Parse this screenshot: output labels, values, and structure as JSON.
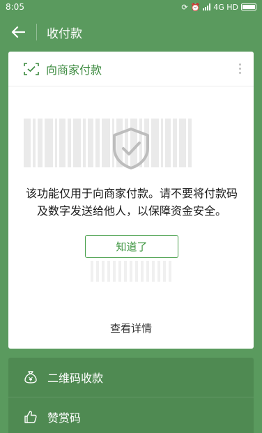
{
  "status_bar": {
    "time": "8:05",
    "network": "4G HD"
  },
  "header": {
    "title": "收付款"
  },
  "card": {
    "title": "向商家付款",
    "notice": "该功能仅用于向商家付款。请不要将付款码及数字发送给他人，以保障资金安全。",
    "ok_label": "知道了",
    "view_details": "查看详情"
  },
  "bottom_list": {
    "items": [
      {
        "label": "二维码收款",
        "icon": "money-bag-icon"
      },
      {
        "label": "赞赏码",
        "icon": "thumbs-up-icon"
      }
    ]
  },
  "colors": {
    "background": "#5a9a5e",
    "accent": "#3b8a3e",
    "list_bg": "#4f8a52"
  }
}
